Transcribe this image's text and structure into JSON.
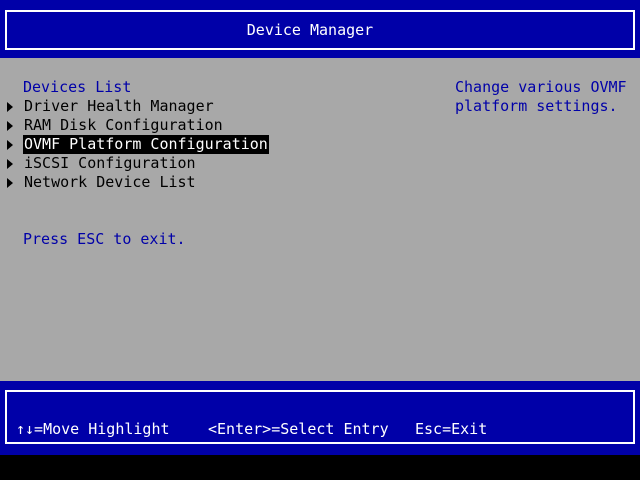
{
  "header": {
    "title": "Device Manager"
  },
  "main": {
    "section_title": "Devices List",
    "items": [
      {
        "label": "Driver Health Manager",
        "selected": false
      },
      {
        "label": "RAM Disk Configuration",
        "selected": false
      },
      {
        "label": "OVMF Platform Configuration",
        "selected": true
      },
      {
        "label": "iSCSI Configuration",
        "selected": false
      },
      {
        "label": "Network Device List",
        "selected": false
      }
    ],
    "exit_hint": "Press ESC to exit.",
    "help_text": "Change various OVMF\nplatform settings."
  },
  "footer": {
    "move_highlight": "↑↓=Move Highlight",
    "select_entry": "<Enter>=Select Entry",
    "exit": "Esc=Exit"
  },
  "colors": {
    "header_bg": "#0000a8",
    "main_bg": "#a8a8a8",
    "accent_text": "#0000a8",
    "selected_bg": "#000000",
    "selected_text": "#ffffff"
  },
  "icons": {
    "menu_arrow": "right-triangle-icon"
  }
}
